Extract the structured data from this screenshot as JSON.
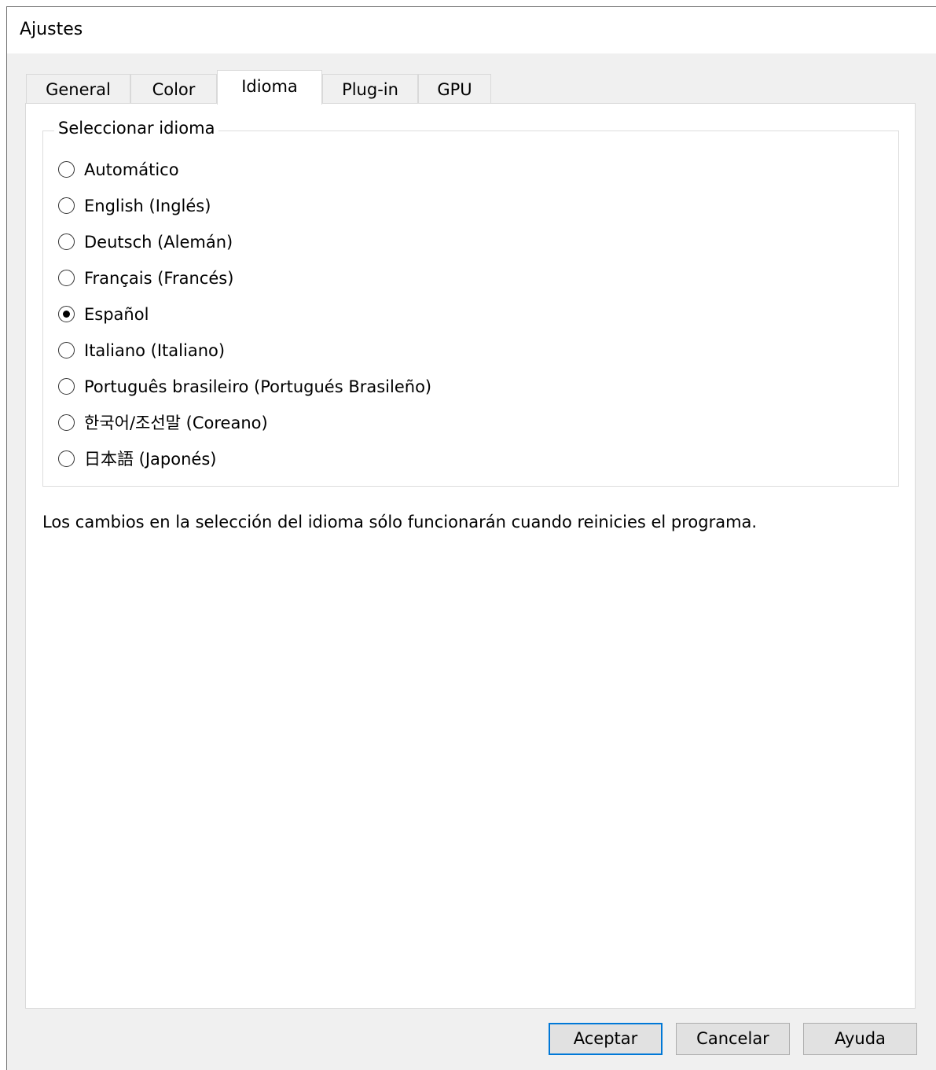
{
  "window": {
    "title": "Ajustes"
  },
  "tabs": [
    {
      "label": "General",
      "active": false
    },
    {
      "label": "Color",
      "active": false
    },
    {
      "label": "Idioma",
      "active": true
    },
    {
      "label": "Plug-in",
      "active": false
    },
    {
      "label": "GPU",
      "active": false
    }
  ],
  "language_group": {
    "legend": "Seleccionar idioma",
    "selected": "Español",
    "options": [
      {
        "label": "Automático",
        "checked": false
      },
      {
        "label": "English (Inglés)",
        "checked": false
      },
      {
        "label": "Deutsch (Alemán)",
        "checked": false
      },
      {
        "label": "Français (Francés)",
        "checked": false
      },
      {
        "label": "Español",
        "checked": true
      },
      {
        "label": "Italiano (Italiano)",
        "checked": false
      },
      {
        "label": "Português brasileiro (Portugués Brasileño)",
        "checked": false
      },
      {
        "label": "한국어/조선말 (Coreano)",
        "checked": false
      },
      {
        "label": "日本語 (Japonés)",
        "checked": false
      }
    ]
  },
  "note": "Los cambios en la selección del idioma sólo funcionarán cuando reinicies el programa.",
  "buttons": {
    "ok": "Aceptar",
    "cancel": "Cancelar",
    "help": "Ayuda"
  },
  "colors": {
    "dialog_background": "#f0f0f0",
    "panel_background": "#ffffff",
    "default_button_border": "#0078d7",
    "button_face": "#e1e1e1"
  }
}
